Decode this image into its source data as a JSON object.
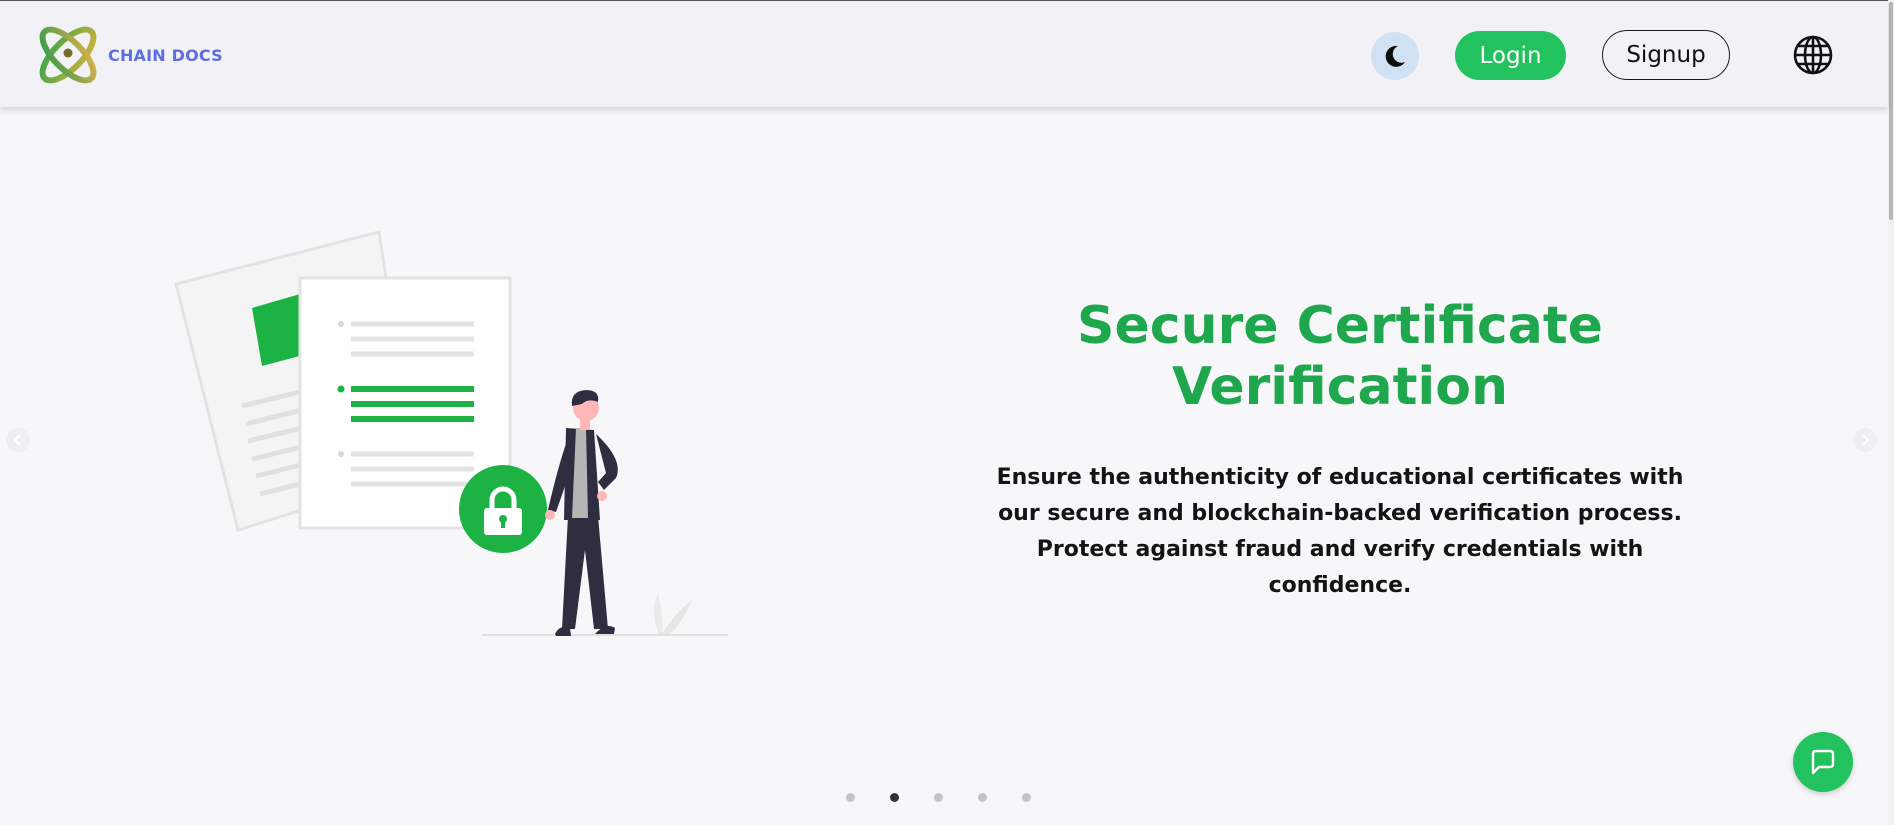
{
  "header": {
    "brand": "CHAIN DOCS",
    "login_label": "Login",
    "signup_label": "Signup",
    "icons": {
      "theme": "moon-icon",
      "language": "globe-icon"
    }
  },
  "slide": {
    "title": "Secure Certificate Verification",
    "description": "Ensure the authenticity of educational certificates with our secure and blockchain-backed verification process. Protect against fraud and verify credentials with confidence."
  },
  "carousel": {
    "slide_count": 5,
    "active_index": 1
  },
  "colors": {
    "accent_green": "#22c35e",
    "title_green": "#1fa74e",
    "brand_blue": "#5c6ee0",
    "background": "#f7f7fa",
    "header_background": "#f2f1f6"
  },
  "chat": {
    "icon": "chat-bubble-icon"
  }
}
